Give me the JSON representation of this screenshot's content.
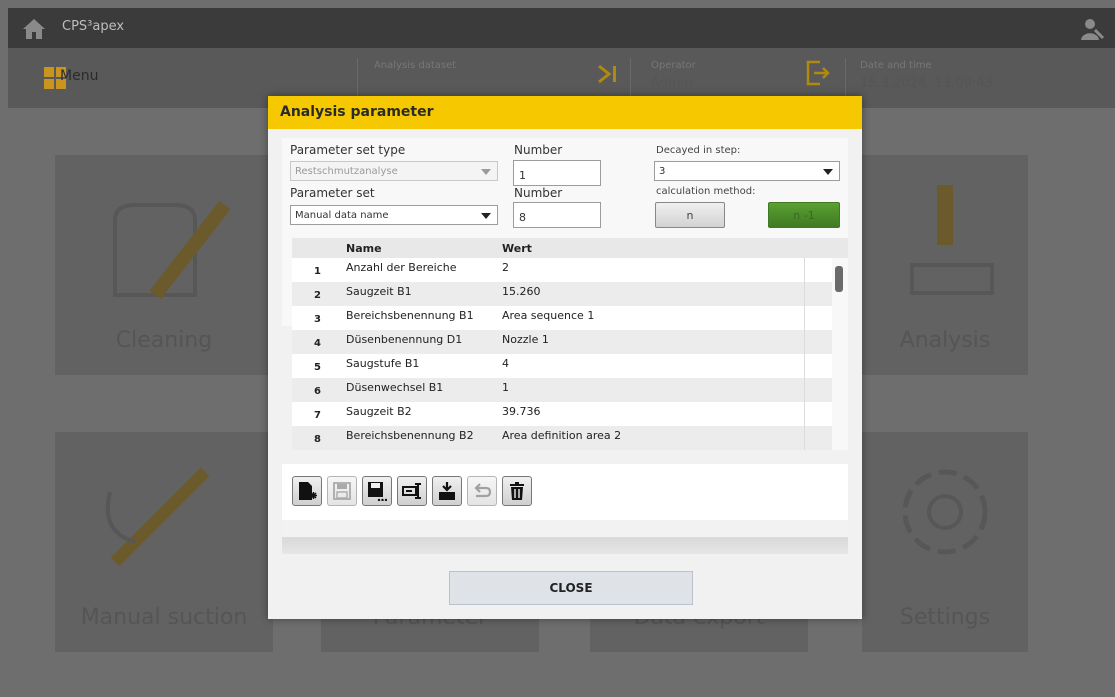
{
  "app": {
    "title": "CPS³apex"
  },
  "header": {
    "menu_label": "Menu",
    "analysis_dataset_label": "Analysis dataset",
    "operator_label": "Operator",
    "operator_value": "Admin",
    "datetime_label": "Date and time",
    "datetime_value": "15.3.2024, 13:09:43"
  },
  "tiles": [
    {
      "label": "Cleaning"
    },
    {
      "label": "Analysis"
    },
    {
      "label": "Manual suction"
    },
    {
      "label": "Parameter"
    },
    {
      "label": "Data export"
    },
    {
      "label": "Settings"
    }
  ],
  "dialog": {
    "title": "Analysis parameter",
    "parameter_set_type_label": "Parameter set type",
    "parameter_set_type_value": "Restschmutzanalyse",
    "number1_label": "Number",
    "number1_value": "1",
    "parameter_set_label": "Parameter set",
    "parameter_set_value": "Manual data name",
    "number2_label": "Number",
    "number2_value": "8",
    "decayed_label": "Decayed in step:",
    "decayed_value": "3",
    "calc_method_label": "calculation method:",
    "calc_n": "n",
    "calc_n1": "n -1",
    "close_label": "CLOSE"
  },
  "table": {
    "columns": [
      "Name",
      "Wert"
    ],
    "rows": [
      {
        "no": "1",
        "name": "Anzahl der Bereiche",
        "value": "2"
      },
      {
        "no": "2",
        "name": "Saugzeit B1",
        "value": "15.260"
      },
      {
        "no": "3",
        "name": "Bereichsbenennung B1",
        "value": "Area sequence 1"
      },
      {
        "no": "4",
        "name": "Düsenbenennung D1",
        "value": "Nozzle 1"
      },
      {
        "no": "5",
        "name": "Saugstufe B1",
        "value": "4"
      },
      {
        "no": "6",
        "name": "Düsenwechsel B1",
        "value": "1"
      },
      {
        "no": "7",
        "name": "Saugzeit B2",
        "value": "39.736"
      },
      {
        "no": "8",
        "name": "Bereichsbenennung B2",
        "value": "Area definition area 2"
      }
    ]
  },
  "toolbar": {
    "icons": [
      "new-file-icon",
      "save-icon",
      "save-as-icon",
      "rename-icon",
      "import-icon",
      "undo-icon",
      "trash-icon"
    ]
  },
  "colors": {
    "accent": "#f5c800",
    "active_green": "#4a8c2a",
    "tile_brand": "#c99520"
  }
}
